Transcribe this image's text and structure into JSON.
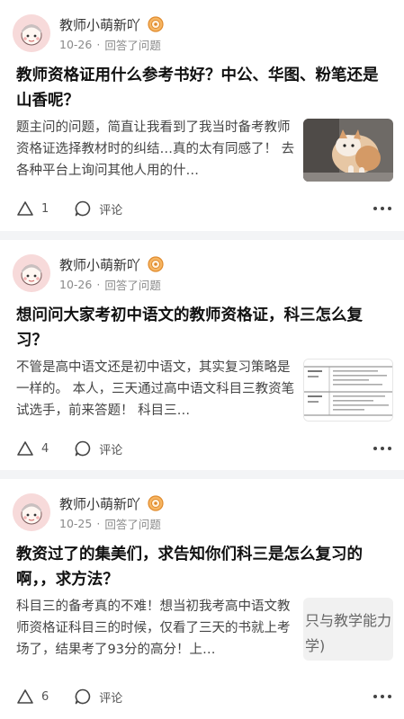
{
  "feed": {
    "posts": [
      {
        "author": "教师小萌新吖",
        "date": "10-26",
        "action": "回答了问题",
        "title": "教师资格证用什么参考书好？中公、华图、粉笔还是山香呢？",
        "excerpt": "题主问的问题，简直让我看到了我当时备考教师资格证选择教材时的纠结…真的太有同感了！ 去各种平台上询问其他人用的什…",
        "thumbnail": "cat-photo",
        "likes": "1",
        "comment_label": "评论"
      },
      {
        "author": "教师小萌新吖",
        "date": "10-26",
        "action": "回答了问题",
        "title": "想问问大家考初中语文的教师资格证，科三怎么复习？",
        "excerpt": "不管是高中语文还是初中语文，其实复习策略是一样的。 本人，三天通过高中语文科目三教资笔试选手，前来答题！ 科目三…",
        "thumbnail": "table-document",
        "likes": "4",
        "comment_label": "评论"
      },
      {
        "author": "教师小萌新吖",
        "date": "10-25",
        "action": "回答了问题",
        "title": "教资过了的集美们，求告知你们科三是怎么复习的啊，，求方法？",
        "excerpt": "科目三的备考真的不难！想当初我考高中语文教师资格证科目三的时候，仅看了三天的书就上考场了，结果考了93分的高分！上…",
        "thumbnail": "text-snippet",
        "thumb_text": "只与教学能力",
        "thumb_text2": "学)",
        "likes": "6",
        "comment_label": "评论"
      }
    ]
  },
  "colors": {
    "separator": "#f3f4f6",
    "avatar_bg": "#f7dada",
    "medal": "#f0a050"
  },
  "icons": [
    "avatar",
    "medal-icon",
    "like-triangle-icon",
    "comment-bubble-icon",
    "more-dots-icon"
  ]
}
